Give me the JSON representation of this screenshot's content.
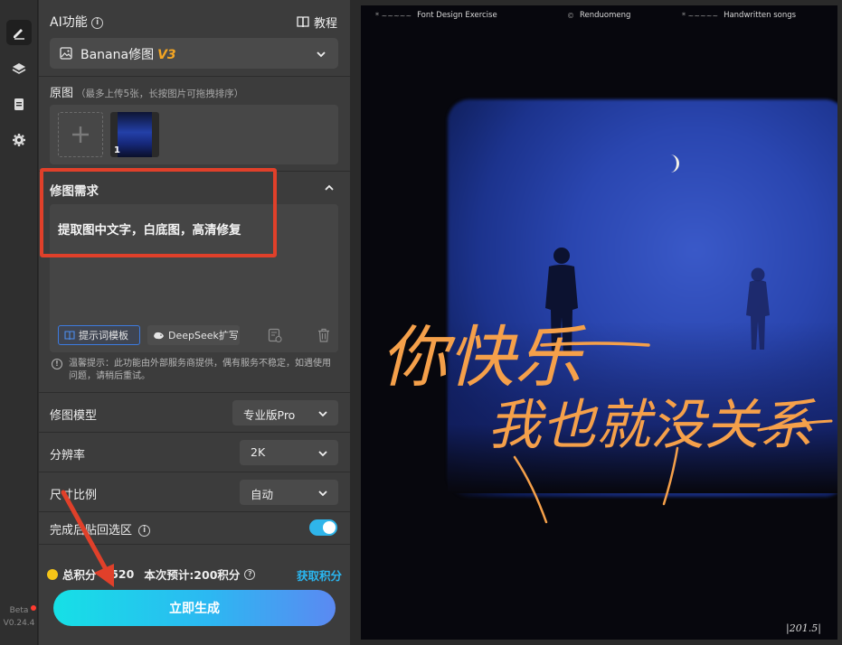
{
  "rail": {
    "version_label": "Beta",
    "version": "V0.24.4"
  },
  "panel": {
    "title": "AI功能",
    "tutorial_label": "教程",
    "model": {
      "name": "Banana修图",
      "version_tag": "V3"
    },
    "original": {
      "label": "原图",
      "hint": "（最多上传5张，长按图片可拖拽排序）",
      "thumb_index": "1"
    },
    "request": {
      "label": "修图需求",
      "text": "提取图中文字，白底图，高清修复",
      "prompt_template_label": "提示词模板",
      "deepseek_label": "DeepSeek扩写"
    },
    "tip": "温馨提示：此功能由外部服务商提供，偶有服务不稳定，如遇使用问题，请稍后重试。",
    "settings": {
      "model_label": "修图模型",
      "model_value": "专业版Pro",
      "resolution_label": "分辨率",
      "resolution_value": "2K",
      "ratio_label": "尺寸比例",
      "ratio_value": "自动",
      "paste_back_label": "完成后贴回选区",
      "paste_back_on": true
    },
    "points": {
      "total_label": "总积分",
      "total_value": "0520",
      "estimate_label": "本次预计:200积分",
      "get_points_label": "获取积分"
    },
    "generate_label": "立即生成"
  },
  "poster": {
    "header_left": "Font Design Exercise",
    "header_center": "Renduomeng",
    "header_right": "Handwritten songs",
    "calligraphy_line1": "你快乐",
    "calligraphy_line2": "我也就没关系",
    "signature": "|201.5|"
  },
  "colors": {
    "accent_blue": "#2ab6f0",
    "highlight_red": "#e0402a",
    "version_orange": "#f5a623",
    "calligraphy_orange": "#f5a04a"
  }
}
